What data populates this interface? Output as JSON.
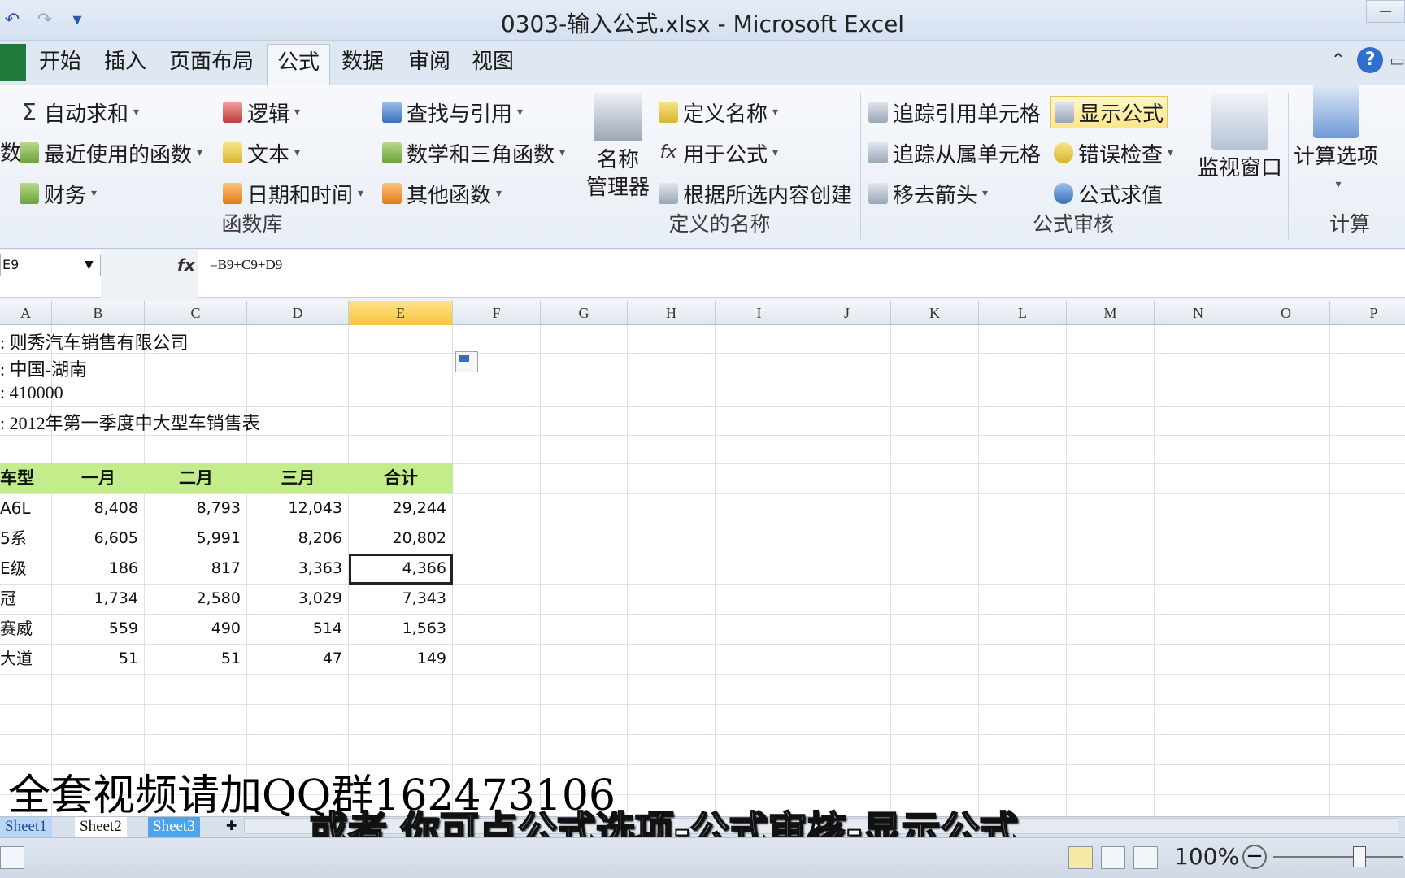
{
  "window": {
    "title": "0303-输入公式.xlsx - Microsoft Excel"
  },
  "tabs": [
    "开始",
    "插入",
    "页面布局",
    "公式",
    "数据",
    "审阅",
    "视图"
  ],
  "active_tab": "公式",
  "ribbon": {
    "function_library": {
      "label": "函数库",
      "left_cut": "数",
      "autosum": "自动求和",
      "recent": "最近使用的函数",
      "finance": "财务",
      "logic": "逻辑",
      "text": "文本",
      "datetime": "日期和时间",
      "lookup": "查找与引用",
      "math": "数学和三角函数",
      "more": "其他函数"
    },
    "defined_names": {
      "label": "定义的名称",
      "name_manager_1": "名称",
      "name_manager_2": "管理器",
      "define_name": "定义名称",
      "use_in_formula": "用于公式",
      "create_from_selection": "根据所选内容创建"
    },
    "formula_auditing": {
      "label": "公式审核",
      "trace_precedents": "追踪引用单元格",
      "trace_dependents": "追踪从属单元格",
      "remove_arrows": "移去箭头",
      "show_formulas": "显示公式",
      "error_checking": "错误检查",
      "evaluate_formula": "公式求值",
      "watch_window": "监视窗口"
    },
    "calculation": {
      "label": "计算",
      "options": "计算选项"
    }
  },
  "formula_bar": {
    "name_box": "E9",
    "formula": "=B9+C9+D9"
  },
  "columns": [
    "A",
    "B",
    "C",
    "D",
    "E",
    "F",
    "G",
    "H",
    "I",
    "J",
    "K",
    "L",
    "M",
    "N",
    "O",
    "P"
  ],
  "selected_column": "E",
  "info_lines": [
    ": 则秀汽车销售有限公司",
    ": 中国-湖南",
    ": 410000",
    ": 2012年第一季度中大型车销售表"
  ],
  "table": {
    "headers": [
      "车型",
      "一月",
      "二月",
      "三月",
      "合计"
    ],
    "rows": [
      [
        "A6L",
        "8,408",
        "8,793",
        "12,043",
        "29,244"
      ],
      [
        "5系",
        "6,605",
        "5,991",
        "8,206",
        "20,802"
      ],
      [
        "E级",
        "186",
        "817",
        "3,363",
        "4,366"
      ],
      [
        "冠",
        "1,734",
        "2,580",
        "3,029",
        "7,343"
      ],
      [
        "赛威",
        "559",
        "490",
        "514",
        "1,563"
      ],
      [
        "大道",
        "51",
        "51",
        "47",
        "149"
      ]
    ]
  },
  "sheets": [
    "Sheet1",
    "Sheet2",
    "Sheet3"
  ],
  "status": {
    "zoom": "100%"
  },
  "overlay": {
    "qq": "全套视频请加QQ群162473106",
    "caption": "或者 你可点公式选项-公式审核-显示公式"
  }
}
